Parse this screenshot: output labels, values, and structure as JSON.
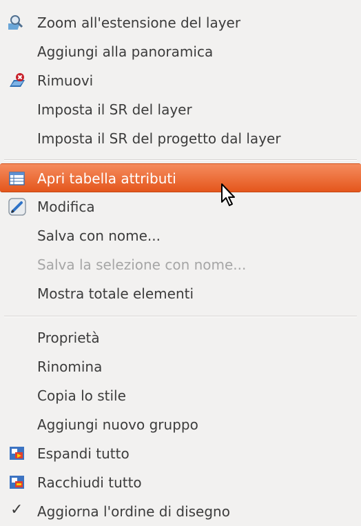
{
  "menu": {
    "items": [
      {
        "label": "Zoom all'estensione del layer",
        "icon": "zoom-layer-icon"
      },
      {
        "label": "Aggiungi alla panoramica"
      },
      {
        "label": "Rimuovi",
        "icon": "remove-layer-icon"
      },
      {
        "label": "Imposta il SR del layer"
      },
      {
        "label": "Imposta il SR del progetto dal layer"
      },
      {
        "label": "Apri tabella attributi",
        "icon": "attribute-table-icon",
        "state": "highlighted"
      },
      {
        "label": "Modifica",
        "icon": "edit-pencil-icon"
      },
      {
        "label": "Salva con nome..."
      },
      {
        "label": "Salva la selezione con nome...",
        "state": "disabled"
      },
      {
        "label": "Mostra totale elementi"
      },
      {
        "label": "Proprietà"
      },
      {
        "label": "Rinomina"
      },
      {
        "label": "Copia lo stile"
      },
      {
        "label": "Aggiungi nuovo gruppo"
      },
      {
        "label": "Espandi tutto",
        "icon": "expand-all-icon"
      },
      {
        "label": "Racchiudi tutto",
        "icon": "collapse-all-icon"
      },
      {
        "label": "Aggiorna l'ordine di disegno",
        "icon": "checkmark-icon",
        "state": "checked"
      }
    ]
  },
  "colors": {
    "highlight": "#e8602a",
    "background": "#f2f1f0",
    "text": "#3c3c3c",
    "disabled_text": "#a6a6a6"
  }
}
